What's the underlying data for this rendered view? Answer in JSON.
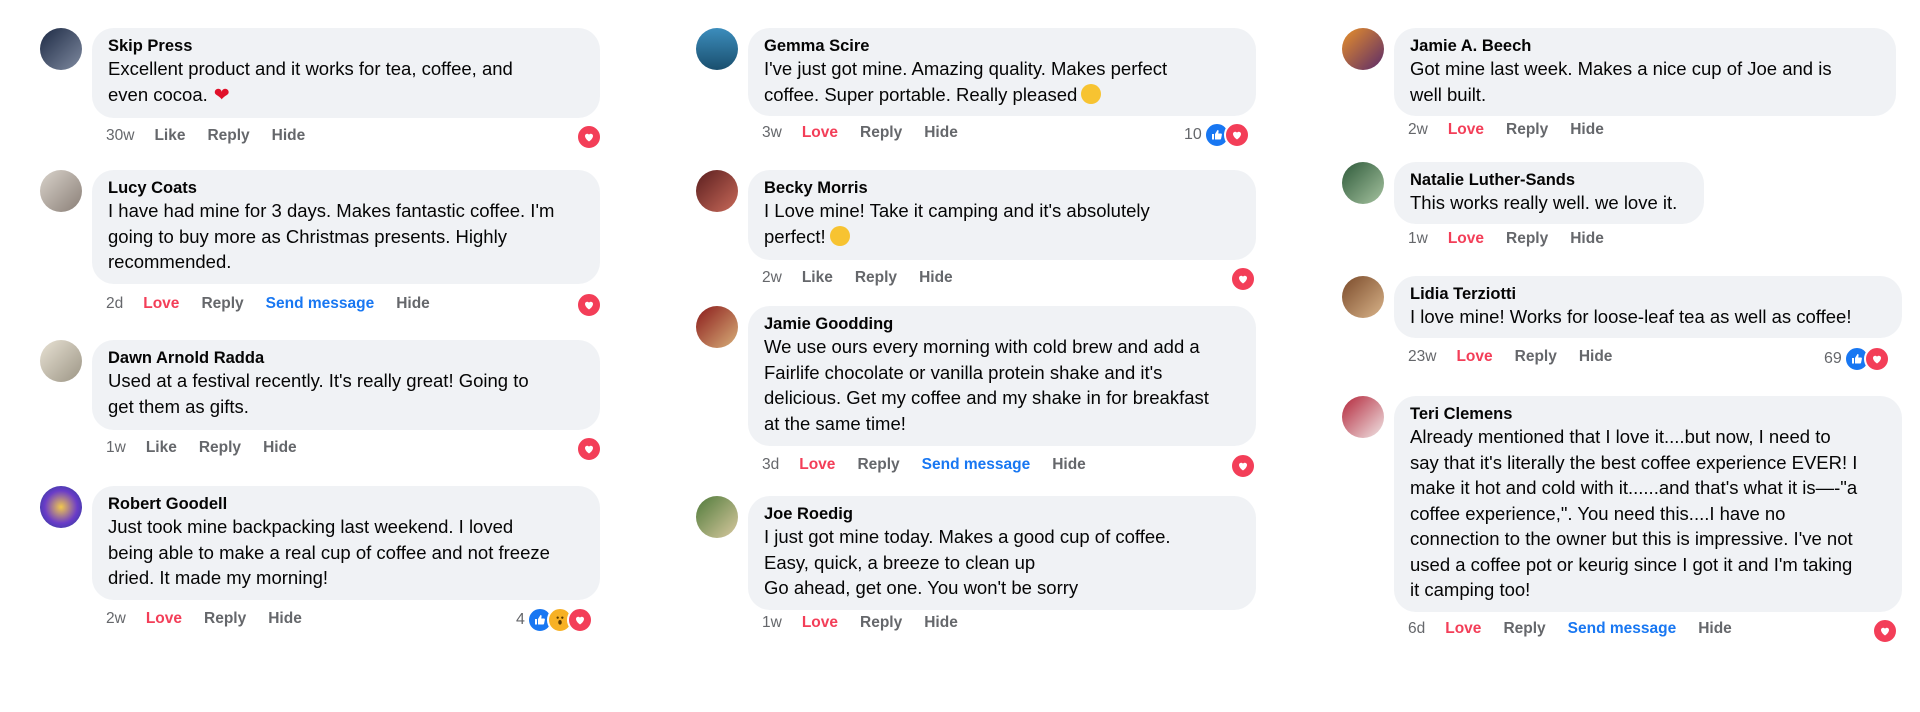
{
  "actions": {
    "like": "Like",
    "love": "Love",
    "reply": "Reply",
    "hide": "Hide",
    "send": "Send message"
  },
  "colors": {
    "love": "#f33e58",
    "link": "#1877f2",
    "bubble": "#f0f2f5",
    "meta": "#65676b"
  },
  "col1": [
    {
      "name": "Skip Press",
      "text": "Excellent product and it works for tea, coffee, and\neven cocoa.",
      "emoji": "red-heart",
      "time": "30w",
      "react": "Like"
    },
    {
      "name": "Lucy Coats",
      "text": "I have had mine for 3 days. Makes fantastic coffee. I'm\ngoing to buy more as Christmas presents. Highly\nrecommended.",
      "time": "2d",
      "react": "Love"
    },
    {
      "name": "Dawn Arnold Radda",
      "text": "Used at a festival recently. It's really great! Going to\nget them as gifts.",
      "time": "1w",
      "react": "Like"
    },
    {
      "name": "Robert Goodell",
      "text": "Just took mine backpacking last weekend. I loved\nbeing able to make a real cup of coffee and not freeze\ndried. It made my morning!",
      "time": "2w",
      "react": "Love",
      "count": "4"
    }
  ],
  "col2": [
    {
      "name": "Gemma Scire",
      "text": "I've just got mine. Amazing quality. Makes perfect\ncoffee. Super portable. Really pleased",
      "emoji": "grin",
      "time": "3w",
      "react": "Love",
      "count": "10"
    },
    {
      "name": "Becky Morris",
      "text": "I Love mine! Take it camping and it's absolutely\nperfect!",
      "emoji": "heart-eyes",
      "time": "2w",
      "react": "Like"
    },
    {
      "name": "Jamie Goodding",
      "text": "We use ours every morning with cold brew and add a\nFairlife chocolate or vanilla protein shake and it's\ndelicious. Get my coffee and my shake in for breakfast\nat the same time!",
      "time": "3d",
      "react": "Love"
    },
    {
      "name": "Joe Roedig",
      "text": " I just got mine today. Makes a good cup of coffee.\nEasy, quick, a breeze to clean up\nGo ahead, get one. You won't be sorry",
      "time": "1w",
      "react": "Love"
    }
  ],
  "col3": [
    {
      "name": "Jamie A. Beech",
      "text": "Got mine last week. Makes a nice cup of Joe and is\nwell built.",
      "time": "2w",
      "react": "Love"
    },
    {
      "name": "Natalie Luther-Sands",
      "text": "This works really well. we love it.",
      "time": "1w",
      "react": "Love"
    },
    {
      "name": "Lidia Terziotti",
      "text": "I love mine! Works for loose-leaf tea as well as coffee!",
      "time": "23w",
      "react": "Love",
      "count": "69"
    },
    {
      "name": "Teri Clemens",
      "text": "Already mentioned that I love it....but now, I need to\nsay that it's literally the best coffee experience EVER! I\nmake it hot and cold with it......and that's what it is—-\"a\ncoffee experience,\". You need this....I have no\nconnection to the owner but this is impressive. I've not\nused a coffee pot or keurig since I got it and I'm taking\nit camping too!",
      "time": "6d",
      "react": "Love"
    }
  ]
}
